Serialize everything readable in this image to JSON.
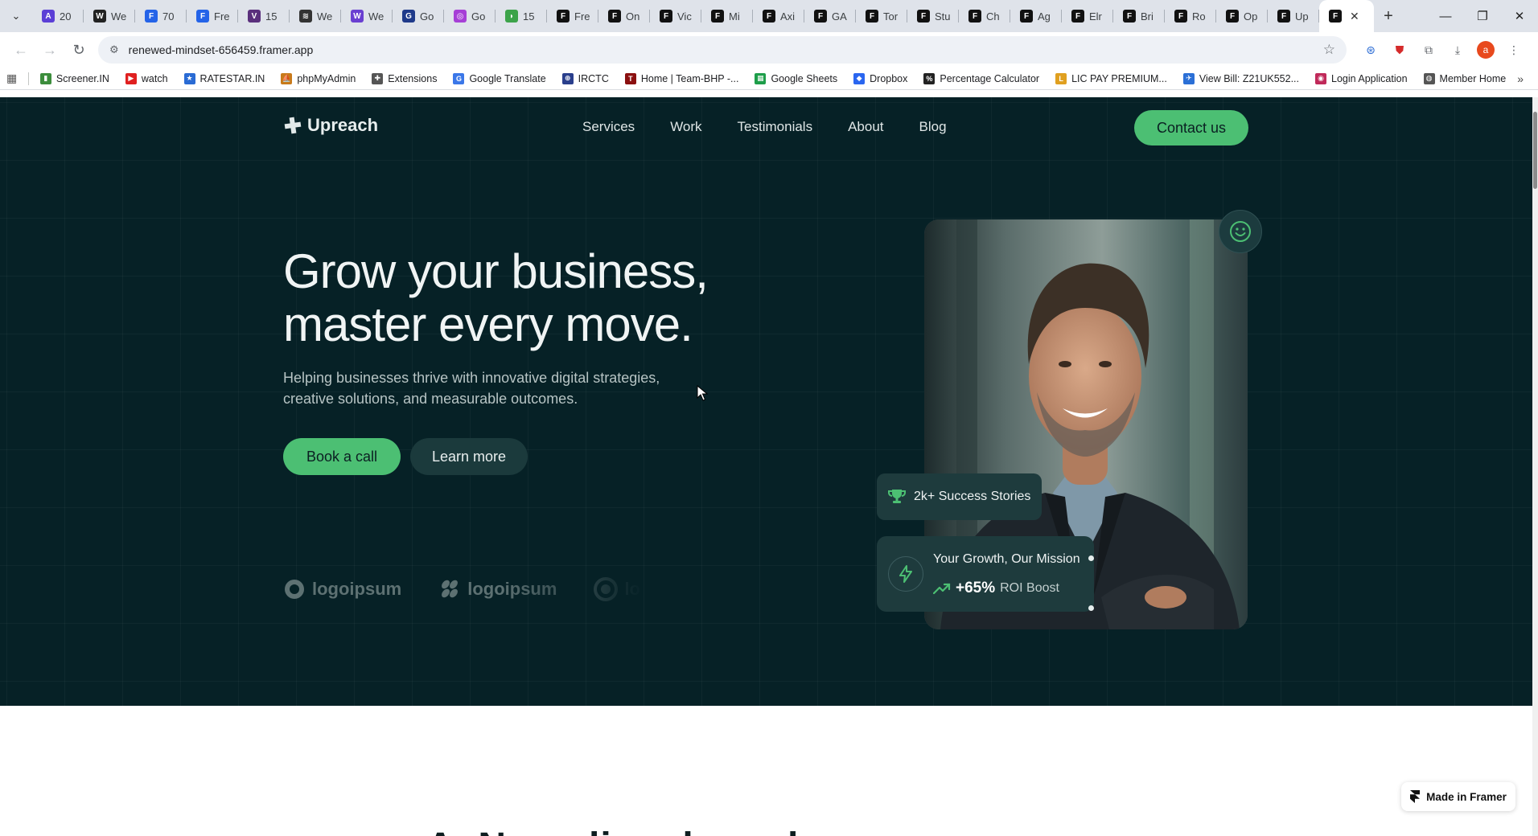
{
  "browser": {
    "tabs": [
      {
        "label": "20",
        "color": "#5b3fd6",
        "glyph": "A"
      },
      {
        "label": "We",
        "color": "#222222",
        "glyph": "W"
      },
      {
        "label": "70",
        "color": "#2463e8",
        "glyph": "F"
      },
      {
        "label": "Fre",
        "color": "#2463e8",
        "glyph": "F"
      },
      {
        "label": "15",
        "color": "#5a2f7c",
        "glyph": "V"
      },
      {
        "label": "We",
        "color": "#333333",
        "glyph": "≋"
      },
      {
        "label": "We",
        "color": "#6a3fd1",
        "glyph": "W"
      },
      {
        "label": "Go",
        "color": "#1f3a8a",
        "glyph": "G"
      },
      {
        "label": "Go",
        "color": "#a63fd6",
        "glyph": "◎"
      },
      {
        "label": "15",
        "color": "#3ca34a",
        "glyph": "◗"
      },
      {
        "label": "Fre",
        "color": "#111111",
        "glyph": "F"
      },
      {
        "label": "On",
        "color": "#111111",
        "glyph": "F"
      },
      {
        "label": "Vic",
        "color": "#111111",
        "glyph": "F"
      },
      {
        "label": "Mi",
        "color": "#111111",
        "glyph": "F"
      },
      {
        "label": "Axi",
        "color": "#111111",
        "glyph": "F"
      },
      {
        "label": "GA",
        "color": "#111111",
        "glyph": "F"
      },
      {
        "label": "Tor",
        "color": "#111111",
        "glyph": "F"
      },
      {
        "label": "Stu",
        "color": "#111111",
        "glyph": "F"
      },
      {
        "label": "Ch",
        "color": "#111111",
        "glyph": "F"
      },
      {
        "label": "Ag",
        "color": "#111111",
        "glyph": "F"
      },
      {
        "label": "Elr",
        "color": "#111111",
        "glyph": "F"
      },
      {
        "label": "Bri",
        "color": "#111111",
        "glyph": "F"
      },
      {
        "label": "Ro",
        "color": "#111111",
        "glyph": "F"
      },
      {
        "label": "Op",
        "color": "#111111",
        "glyph": "F"
      },
      {
        "label": "Up",
        "color": "#111111",
        "glyph": "F"
      }
    ],
    "active_tab_glyph": "F",
    "url": "renewed-mindset-656459.framer.app",
    "bookmarks": [
      {
        "label": "Screener.IN",
        "color": "#3c8d3c",
        "glyph": "▮"
      },
      {
        "label": "watch",
        "color": "#e02020",
        "glyph": "▶"
      },
      {
        "label": "RATESTAR.IN",
        "color": "#2a6bd4",
        "glyph": "★"
      },
      {
        "label": "phpMyAdmin",
        "color": "#c87a1a",
        "glyph": "⛵"
      },
      {
        "label": "Extensions",
        "color": "#555555",
        "glyph": "✚"
      },
      {
        "label": "Google Translate",
        "color": "#3b77e8",
        "glyph": "G"
      },
      {
        "label": "IRCTC",
        "color": "#2a3f8c",
        "glyph": "⊕"
      },
      {
        "label": "Home | Team-BHP -...",
        "color": "#8b1010",
        "glyph": "T"
      },
      {
        "label": "Google Sheets",
        "color": "#1e9e4a",
        "glyph": "▦"
      },
      {
        "label": "Dropbox",
        "color": "#2a66f0",
        "glyph": "◆"
      },
      {
        "label": "Percentage Calculator",
        "color": "#222222",
        "glyph": "%"
      },
      {
        "label": "LIC PAY PREMIUM...",
        "color": "#e0a020",
        "glyph": "L"
      },
      {
        "label": "View Bill: Z21UK552...",
        "color": "#2b6fd6",
        "glyph": "✈"
      },
      {
        "label": "Login Application",
        "color": "#c02a5a",
        "glyph": "◉"
      },
      {
        "label": "Member Home",
        "color": "#555555",
        "glyph": "◍"
      }
    ]
  },
  "site": {
    "brand": "Upreach",
    "nav": [
      "Services",
      "Work",
      "Testimonials",
      "About",
      "Blog"
    ],
    "contact_label": "Contact us",
    "headline_line1": "Grow your business,",
    "headline_line2": "master every move.",
    "subline": "Helping businesses thrive with innovative digital strategies, creative solutions, and measurable outcomes.",
    "book_label": "Book a call",
    "learn_label": "Learn more",
    "partner_logos": [
      "logoipsum",
      "logoipsum",
      "lo"
    ],
    "stat_card": "2k+ Success Stories",
    "mission_title": "Your Growth, Our Mission",
    "roi_value": "+65%",
    "roi_label": "ROI Boost",
    "next_section_peek": "A. N. ... di ... d ... . d ...",
    "framer_badge": "Made in Framer",
    "colors": {
      "hero_bg": "#062126",
      "accent": "#4cbf73",
      "card": "#1e3b3d"
    }
  }
}
